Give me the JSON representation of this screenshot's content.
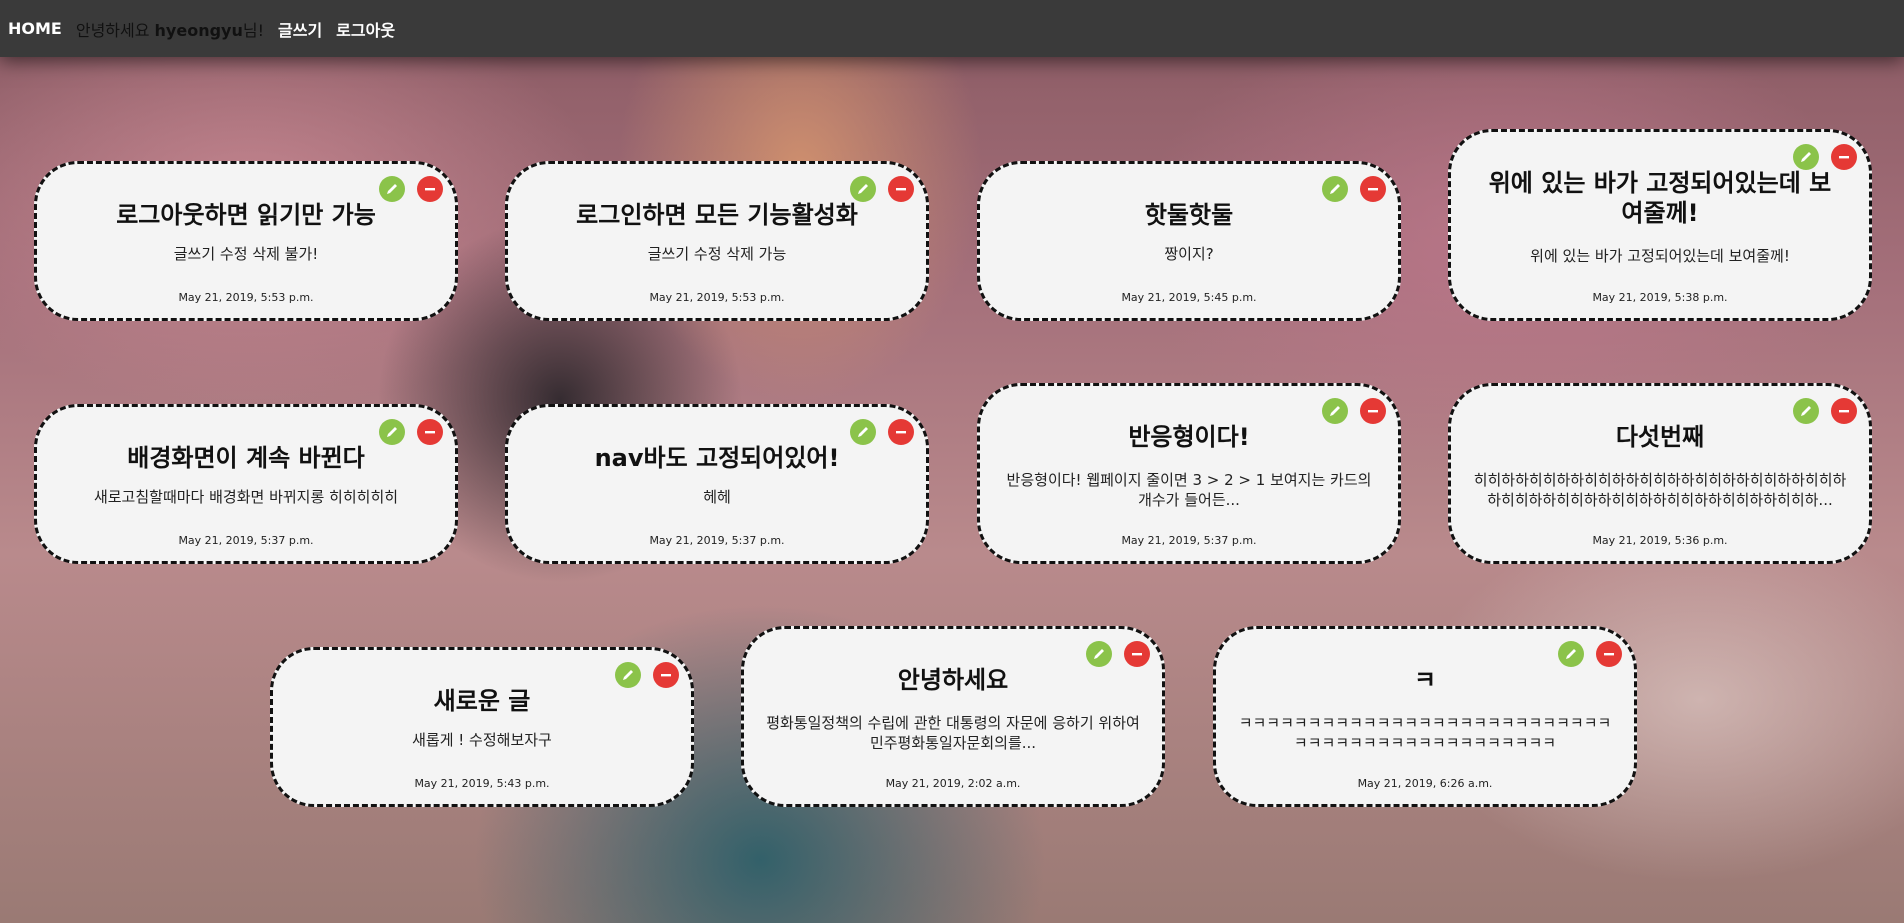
{
  "nav": {
    "home": "HOME",
    "greeting_prefix": "안녕하세요 ",
    "username": "hyeongyu",
    "greeting_suffix": "님!",
    "write": "글쓰기",
    "logout": "로그아웃"
  },
  "icons": {
    "edit": "pencil-icon",
    "delete": "minus-icon"
  },
  "colors": {
    "edit": "#8bc34a",
    "delete": "#e53935",
    "nav": "#3a3a3a",
    "card": "#f4f4f4"
  },
  "posts": [
    {
      "title": "로그아웃하면 읽기만 가능",
      "body": "글쓰기 수정 삭제 불가!",
      "date": "May 21, 2019, 5:53 p.m."
    },
    {
      "title": "로그인하면 모든 기능활성화",
      "body": "글쓰기 수정 삭제 가능",
      "date": "May 21, 2019, 5:53 p.m."
    },
    {
      "title": "핫둘핫둘",
      "body": "짱이지?",
      "date": "May 21, 2019, 5:45 p.m."
    },
    {
      "title": "위에 있는 바가 고정되어있는데 보여줄께!",
      "body": "위에 있는 바가 고정되어있는데 보여줄께!",
      "date": "May 21, 2019, 5:38 p.m."
    },
    {
      "title": "배경화면이 계속 바뀐다",
      "body": "새로고침할때마다 배경화면 바뀌지롱 히히히히히",
      "date": "May 21, 2019, 5:37 p.m."
    },
    {
      "title": "nav바도 고정되어있어!",
      "body": "헤헤",
      "date": "May 21, 2019, 5:37 p.m."
    },
    {
      "title": "반응형이다!",
      "body": "반응형이다! 웹페이지 줄이면 3 > 2 > 1 보여지는 카드의 개수가 들어든...",
      "date": "May 21, 2019, 5:37 p.m."
    },
    {
      "title": "다섯번째",
      "body": "히히하하히히하하히히하하히히하하히히하하히히하하히히하하히히하하히히하하히히하하히히하하히히하하히히하...",
      "date": "May 21, 2019, 5:36 p.m."
    },
    {
      "title": "새로운 글",
      "body": "새롭게 ! 수정해보자구",
      "date": "May 21, 2019, 5:43 p.m."
    },
    {
      "title": "안녕하세요",
      "body": "평화통일정책의 수립에 관한 대통령의 자문에 응하기 위하여 민주평화통일자문회의를...",
      "date": "May 21, 2019, 2:02 a.m."
    },
    {
      "title": "ㅋ",
      "body": "ㅋㅋㅋㅋㅋㅋㅋㅋㅋㅋㅋㅋㅋㅋㅋㅋㅋㅋㅋㅋㅋㅋㅋㅋㅋㅋㅋㅋㅋㅋㅋㅋㅋㅋㅋㅋㅋㅋㅋㅋㅋㅋㅋㅋㅋㅋ",
      "date": "May 21, 2019, 6:26 a.m."
    }
  ]
}
